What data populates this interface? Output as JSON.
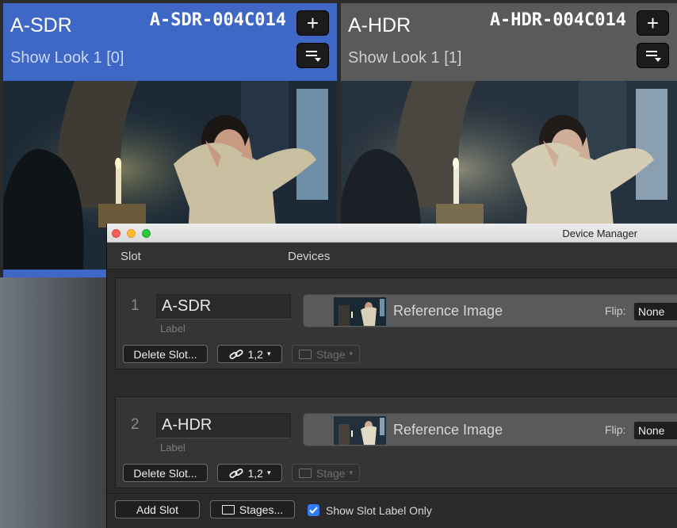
{
  "viewers": [
    {
      "name": "A-SDR",
      "clip": "A-SDR-004C014",
      "look": "Show Look 1 [0]",
      "plus_label": "+",
      "bg_color": "#3f67c5",
      "active": true
    },
    {
      "name": "A-HDR",
      "clip": "A-HDR-004C014",
      "look": "Show Look 1 [1]",
      "plus_label": "+",
      "bg_color": "#5a5a5a",
      "active": false
    }
  ],
  "device_manager": {
    "title": "Device Manager",
    "columns": {
      "slot": "Slot",
      "devices": "Devices"
    },
    "slots": [
      {
        "number": "1",
        "label_value": "A-SDR",
        "label_caption": "Label",
        "device_name": "Reference Image",
        "flip_label": "Flip:",
        "flip_value": "None",
        "delete_label": "Delete Slot...",
        "route_value": "1,2",
        "stage_label": "Stage"
      },
      {
        "number": "2",
        "label_value": "A-HDR",
        "label_caption": "Label",
        "device_name": "Reference Image",
        "flip_label": "Flip:",
        "flip_value": "None",
        "delete_label": "Delete Slot...",
        "route_value": "1,2",
        "stage_label": "Stage"
      }
    ],
    "footer": {
      "add_slot": "Add Slot",
      "stages": "Stages...",
      "show_label_only": "Show Slot Label Only",
      "show_label_only_checked": true
    }
  },
  "colors": {
    "accent": "#2f7cf6",
    "sdr_panel": "#3f67c5"
  }
}
